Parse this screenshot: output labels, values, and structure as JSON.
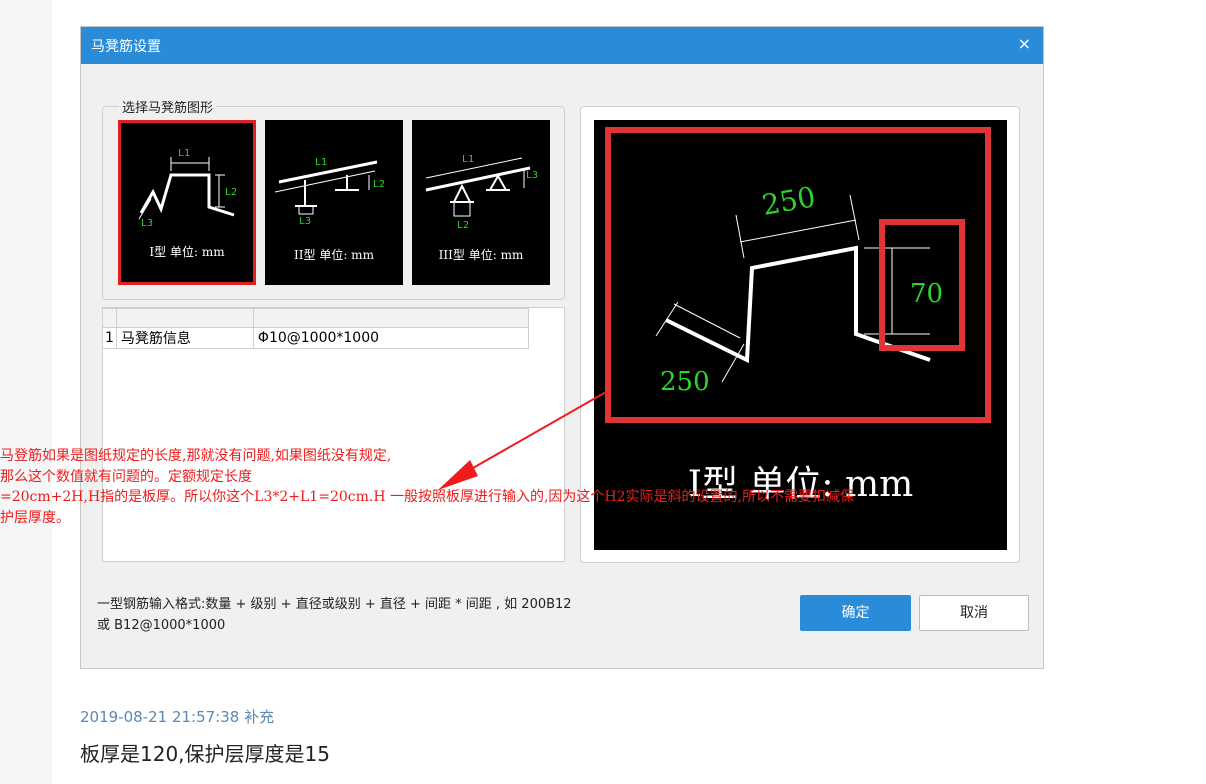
{
  "dialog": {
    "title": "马凳筋设置",
    "close_glyph": "×",
    "group_label": "选择马凳筋图形",
    "shapes": [
      {
        "caption": "I型 单位: mm",
        "selected": true,
        "dims": [
          "L1",
          "L2",
          "L3"
        ]
      },
      {
        "caption": "II型 单位: mm",
        "selected": false,
        "dims": [
          "L1",
          "L2",
          "L3"
        ]
      },
      {
        "caption": "III型 单位: mm",
        "selected": false,
        "dims": [
          "L1",
          "L2",
          "L3"
        ]
      }
    ],
    "table": {
      "rows": [
        {
          "index": "1",
          "name": "马凳筋信息",
          "value": "Φ10@1000*1000"
        }
      ]
    },
    "preview": {
      "caption": "I型 单位: mm",
      "dim_top": "250",
      "dim_right": "70",
      "dim_left": "250"
    },
    "hint_line1": "一型钢筋输入格式:数量 + 级别 + 直径或级别 + 直径 + 间距 * 间距 , 如 200B12",
    "hint_line2": "或 B12@1000*1000",
    "ok_label": "确定",
    "cancel_label": "取消"
  },
  "annotation": "马登筋如果是图纸规定的长度,那就没有问题,如果图纸没有规定,\n那么这个数值就有问题的。定额规定长度\n=20cm+2H,H指的是板厚。所以你这个L3*2+L1=20cm.H 一般按照板厚进行输入的,因为这个H2实际是斜的设置的,所以不需要扣减保\n护层厚度。",
  "post": {
    "timestamp": "2019-08-21 21:57:38 补充",
    "reply_text": "板厚是120,保护层厚度是15"
  },
  "colors": {
    "titlebar": "#2a8cd8",
    "annotation_red": "#ee1c1c",
    "dim_green": "#29d629",
    "selection_red": "#e02020"
  }
}
